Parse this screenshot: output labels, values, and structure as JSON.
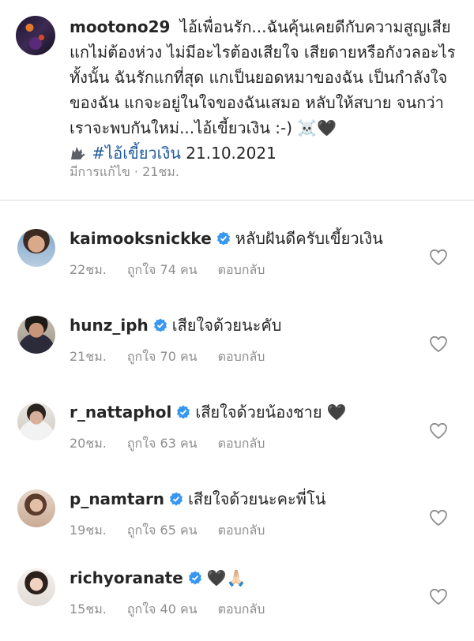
{
  "caption": {
    "username": "mootono29",
    "text": "ไอ้เพื่อนรัก...ฉันคุ้นเคยดีกับความสูญเสีย แกไม่ต้องห่วง ไม่มีอะไรต้องเสียใจ เสียดายหรือกังวลอะไรทั้งนั้น ฉันรักแกที่สุด แกเป็นยอดหมาของฉัน เป็นกำลังใจของฉัน แกจะอยู่ในใจของฉันเสมอ หลับให้สบาย จนกว่าเราจะพบกันใหม่...ไอ้เขี้ยวเงิน :-)",
    "hashtag": "#ไอ้เขี้ยวเงิน",
    "date": "21.10.2021",
    "emoji_skull": "☠️",
    "emoji_heart": "🖤",
    "edited": "มีการแก้ไข",
    "time": "21ชม."
  },
  "comments": [
    {
      "username": "kaimooksnickke",
      "text": "หลับฝันดีครับเขี้ยวเงิน",
      "emoji": "",
      "time": "22ชม.",
      "likes": "ถูกใจ 74 คน",
      "reply": "ตอบกลับ"
    },
    {
      "username": "hunz_iph",
      "text": "เสียใจด้วยนะคับ",
      "emoji": "",
      "time": "21ชม.",
      "likes": "ถูกใจ 70 คน",
      "reply": "ตอบกลับ"
    },
    {
      "username": "r_nattaphol",
      "text": "เสียใจด้วยน้องชาย",
      "emoji": "🖤",
      "time": "20ชม.",
      "likes": "ถูกใจ 63 คน",
      "reply": "ตอบกลับ"
    },
    {
      "username": "p_namtarn",
      "text": "เสียใจด้วยนะคะพี่โน่",
      "emoji": "",
      "time": "19ชม.",
      "likes": "ถูกใจ 65 คน",
      "reply": "ตอบกลับ"
    },
    {
      "username": "richyoranate",
      "text": "",
      "emoji": "🖤🙏🏻",
      "time": "15ชม.",
      "likes": "ถูกใจ 40 คน",
      "reply": "ตอบกลับ"
    }
  ],
  "colors": {
    "verified": "#3897f0",
    "hashtag": "#1f5a9e",
    "muted": "#8e8e8e"
  }
}
